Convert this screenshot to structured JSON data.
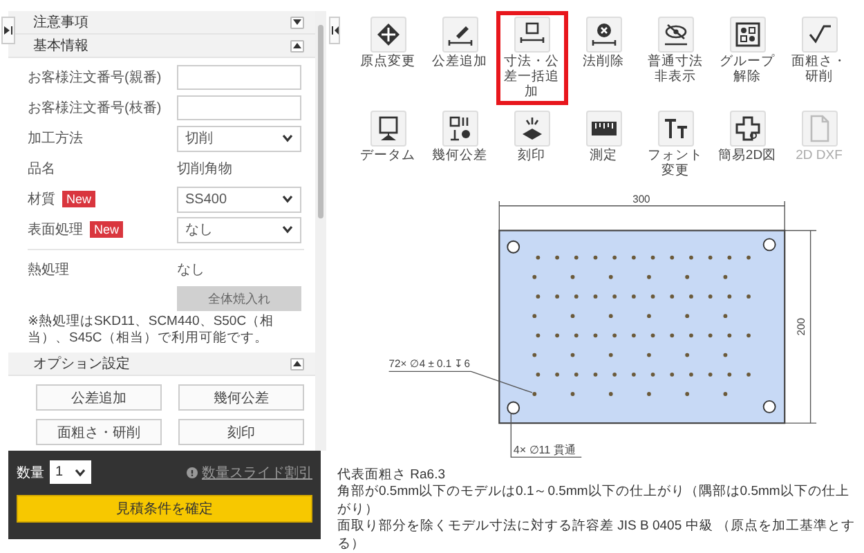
{
  "sidebar": {
    "sections": [
      {
        "title": "注意事項",
        "expanded": false
      },
      {
        "title": "基本情報",
        "expanded": true,
        "fields": [
          {
            "kind": "input",
            "label": "お客様注文番号(親番)"
          },
          {
            "kind": "input",
            "label": "お客様注文番号(枝番)"
          },
          {
            "kind": "select",
            "label": "加工方法",
            "value": "切削"
          },
          {
            "kind": "text",
            "label": "品名",
            "value": "切削角物"
          },
          {
            "kind": "select",
            "label": "材質",
            "badge": "New",
            "value": "SS400"
          },
          {
            "kind": "select",
            "label": "表面処理",
            "badge": "New",
            "value": "なし"
          },
          {
            "kind": "text",
            "label": "熱処理",
            "value": "なし"
          }
        ],
        "apply_button": {
          "label": "全体焼入れ",
          "disabled": true
        },
        "note": "※熱処理はSKD11、SCM440、S50C（相当）、S45C（相当）で利用可能です。"
      },
      {
        "title": "オプション設定",
        "expanded": true,
        "buttons": [
          "公差追加",
          "幾何公差",
          "面粗さ・研削",
          "刻印"
        ]
      }
    ]
  },
  "footer": {
    "quantity_label": "数量",
    "quantity": "1",
    "discount_link": "数量スライド割引",
    "confirm_button": "見積条件を確定"
  },
  "toolbar": {
    "items": [
      {
        "kind": "origin",
        "label": "原点変更",
        "highlighted": false,
        "disabled": false
      },
      {
        "kind": "tolerance",
        "label": "公差追加",
        "highlighted": false,
        "disabled": false
      },
      {
        "kind": "dimension",
        "label": "寸法・公差一括追加",
        "highlighted": true,
        "disabled": false
      },
      {
        "kind": "delete",
        "label": "法削除",
        "highlighted": false,
        "disabled": false
      },
      {
        "kind": "hide",
        "label": "普通寸法非表示",
        "highlighted": false,
        "disabled": false
      },
      {
        "kind": "ungroup",
        "label": "グループ解除",
        "highlighted": false,
        "disabled": false
      },
      {
        "kind": "roughness",
        "label": "面粗さ・研削",
        "highlighted": false,
        "disabled": false
      },
      {
        "kind": "datum",
        "label": "データム",
        "highlighted": false,
        "disabled": false
      },
      {
        "kind": "geometric",
        "label": "幾何公差",
        "highlighted": false,
        "disabled": false
      },
      {
        "kind": "engrave",
        "label": "刻印",
        "highlighted": false,
        "disabled": false
      },
      {
        "kind": "measure",
        "label": "測定",
        "highlighted": false,
        "disabled": false
      },
      {
        "kind": "font",
        "label": "フォント変更",
        "highlighted": false,
        "disabled": false
      },
      {
        "kind": "simple2d",
        "label": "簡易2D図",
        "highlighted": false,
        "disabled": false
      },
      {
        "kind": "dxf",
        "label": "2D DXF",
        "highlighted": false,
        "disabled": true
      }
    ]
  },
  "drawing": {
    "width_dimension": "300",
    "height_dimension": "200",
    "hole_callout": "72× ∅4 ± 0.1 ↧6",
    "corner_hole_callout": "4× ∅11 貫通"
  },
  "notes": [
    "代表面粗さ Ra6.3",
    "角部が0.5mm以下のモデルは0.1～0.5mm以下の仕上がり（隅部は0.5mm以下の仕上がり）",
    "面取り部分を除くモデル寸法に対する許容差 JIS B 0405 中級 （原点を加工基準とする）"
  ]
}
